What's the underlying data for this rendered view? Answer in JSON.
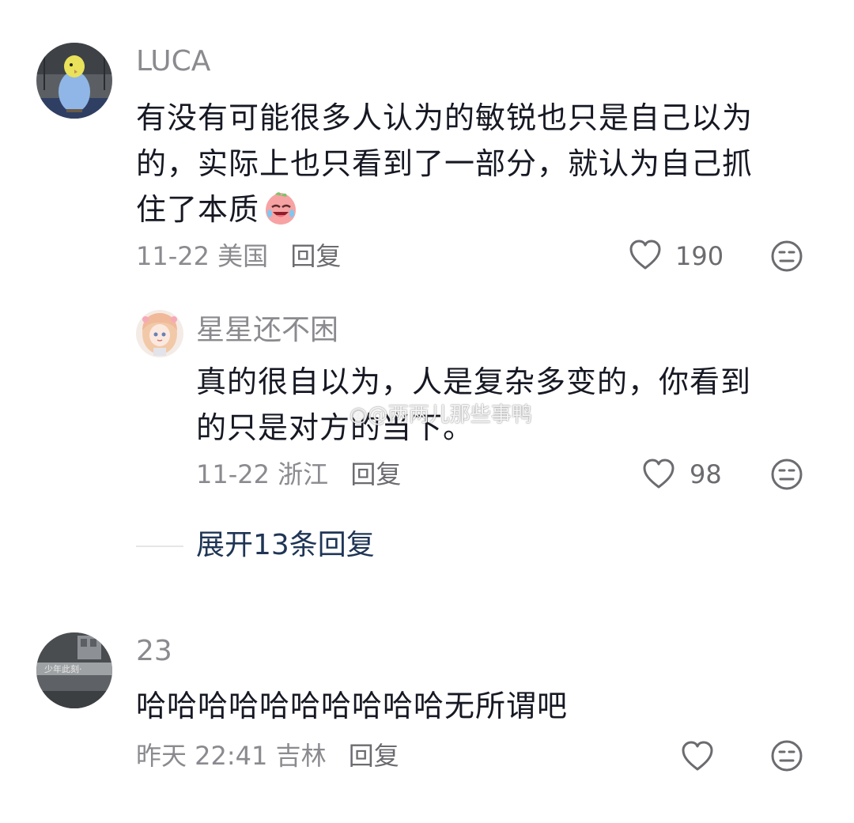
{
  "comments": [
    {
      "username": "LUCA",
      "text_lines": [
        "有没有可能很多人认为的敏锐也只是自己以为",
        "的，实际上也只看到了一部分，就认为自己抓",
        "住了本质"
      ],
      "emoji": "laughing-crying-peach-emoji",
      "date": "11-22",
      "location": "美国",
      "reply_label": "回复",
      "likes": "190",
      "avatar": "parakeet-avatar",
      "replies": [
        {
          "username": "星星还不困",
          "text_lines": [
            "真的很自以为，人是复杂多变的，你看到",
            "的只是对方的当下。"
          ],
          "date": "11-22",
          "location": "浙江",
          "reply_label": "回复",
          "likes": "98",
          "avatar": "anime-girl-avatar"
        }
      ],
      "expand_label": "展开13条回复"
    },
    {
      "username": "23",
      "text_lines": [
        "哈哈哈哈哈哈哈哈哈哈无所谓吧"
      ],
      "date": "昨天 22:41",
      "location": "吉林",
      "reply_label": "回复",
      "likes": "",
      "avatar": "street-photo-avatar"
    }
  ],
  "watermark": "@两两儿那些事鸭",
  "icons": {
    "like": "heart-outline-icon",
    "dislike": "neutral-face-icon"
  },
  "colors": {
    "text": "#161823",
    "meta": "#8a8a8f",
    "expand": "#1f3555"
  }
}
